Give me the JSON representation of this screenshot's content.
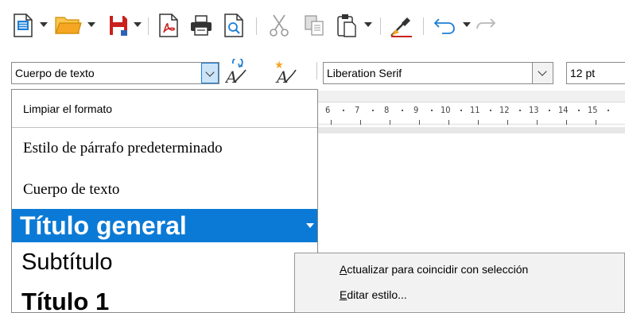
{
  "toolbar": {
    "icons": [
      "new-document-icon",
      "open-folder-icon",
      "save-icon",
      "export-pdf-icon",
      "print-icon",
      "print-preview-icon",
      "cut-icon",
      "copy-icon",
      "paste-icon",
      "clone-formatting-icon",
      "undo-icon",
      "redo-icon"
    ]
  },
  "formatting": {
    "paragraph_style": "Cuerpo de texto",
    "font_name": "Liberation Serif",
    "font_size": "12 pt"
  },
  "ruler": {
    "labels": [
      "6",
      "7",
      "8",
      "9",
      "10",
      "11",
      "12",
      "13",
      "14",
      "15"
    ]
  },
  "style_dropdown": {
    "clear_label": "Limpiar el formato",
    "items": [
      "Estilo de párrafo predeterminado",
      "Cuerpo de texto",
      "Título general",
      "Subtítulo",
      "Título 1"
    ],
    "selected_index": 2
  },
  "context_menu": {
    "update_first": "A",
    "update_rest": "ctualizar para coincidir con selección",
    "edit_first": "E",
    "edit_rest": "ditar estilo..."
  },
  "colors": {
    "selection": "#0b7ad6",
    "save_red": "#c9211e",
    "folder_orange": "#f5a623",
    "doc_blue": "#1c7ed6"
  }
}
